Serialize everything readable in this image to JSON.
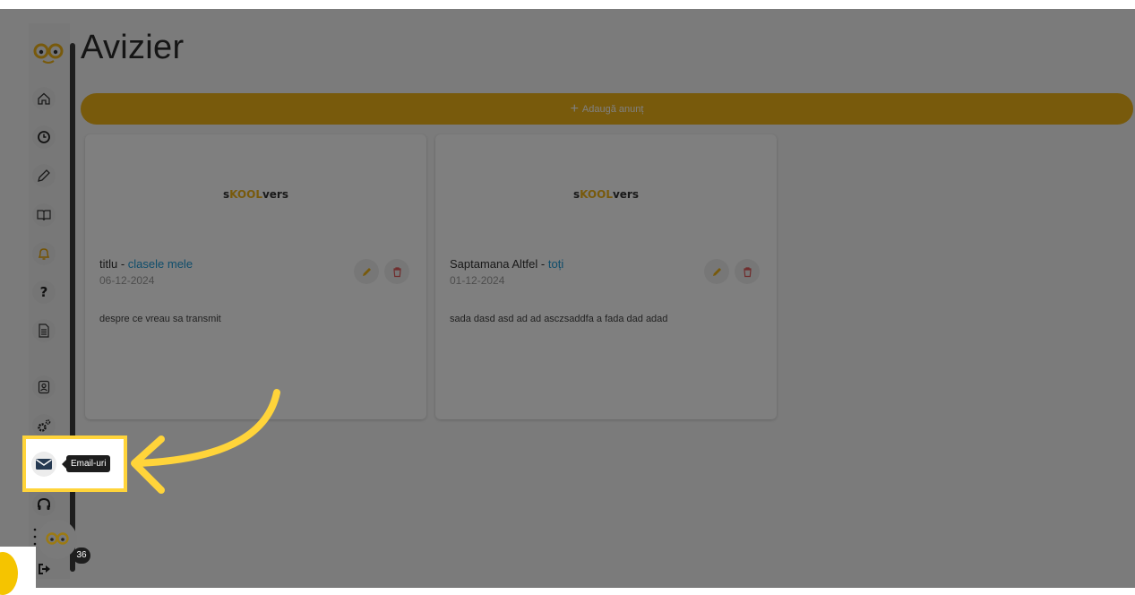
{
  "page": {
    "title": "Avizier"
  },
  "actions": {
    "add_label": "Adaugă anunț"
  },
  "colors": {
    "accent": "#f0b419",
    "link": "#1e9bd7",
    "highlight": "#ffd43a"
  },
  "brand": {
    "prefix": "s",
    "mid": "KOOL",
    "suffix": "vers"
  },
  "announcements": [
    {
      "title": "titlu",
      "separator": " - ",
      "audience": "clasele mele",
      "date": "06-12-2024",
      "body": "despre ce vreau sa transmit"
    },
    {
      "title": "Saptamana Altfel",
      "separator": " - ",
      "audience": "toți",
      "date": "01-12-2024",
      "body": "sada dasd asd ad ad asczsaddfa a fada dad adad"
    }
  ],
  "sidebar": {
    "icons": [
      "logo",
      "home-icon",
      "clock-icon",
      "pencil-icon",
      "book-icon",
      "bell-icon",
      "question-icon",
      "document-icon",
      "contact-card-icon",
      "gears-icon",
      "mail-icon",
      "headset-icon",
      "logout-icon"
    ]
  },
  "tooltip": {
    "text": "Email-uri"
  },
  "chat": {
    "badge_count": "36"
  }
}
